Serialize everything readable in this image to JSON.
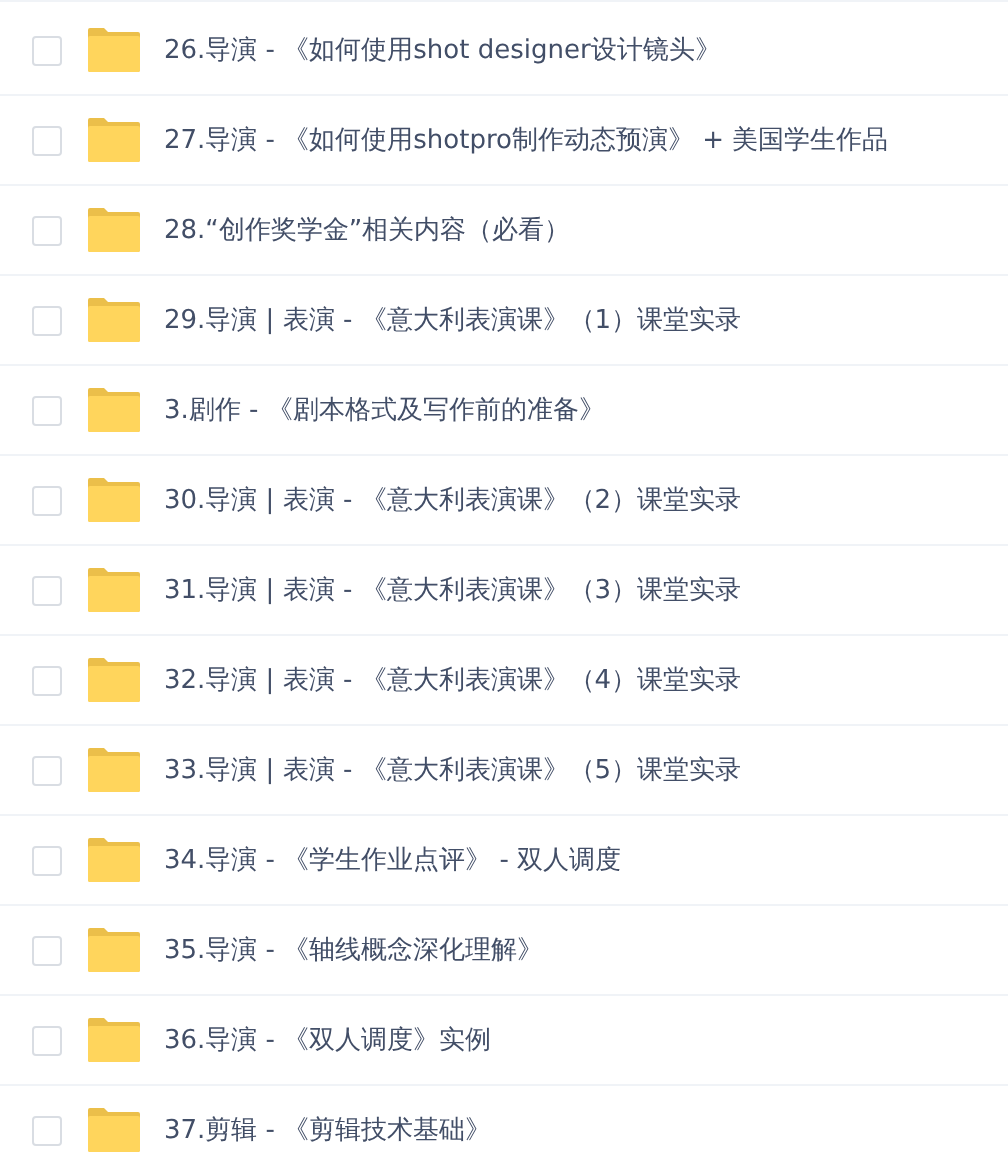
{
  "files": [
    {
      "name": "26.导演 - 《如何使用shot designer设计镜头》",
      "checked": false
    },
    {
      "name": "27.导演 - 《如何使用shotpro制作动态预演》 + 美国学生作品",
      "checked": false
    },
    {
      "name": "28.“创作奖学金”相关内容（必看）",
      "checked": false
    },
    {
      "name": "29.导演 | 表演 - 《意大利表演课》（1）课堂实录",
      "checked": false
    },
    {
      "name": "3.剧作 - 《剧本格式及写作前的准备》",
      "checked": false
    },
    {
      "name": "30.导演 | 表演 - 《意大利表演课》（2）课堂实录",
      "checked": false
    },
    {
      "name": "31.导演 | 表演 - 《意大利表演课》（3）课堂实录",
      "checked": false
    },
    {
      "name": "32.导演 | 表演 - 《意大利表演课》（4）课堂实录",
      "checked": false
    },
    {
      "name": "33.导演 | 表演 - 《意大利表演课》（5）课堂实录",
      "checked": false
    },
    {
      "name": "34.导演 - 《学生作业点评》 - 双人调度",
      "checked": false
    },
    {
      "name": "35.导演 - 《轴线概念深化理解》",
      "checked": false
    },
    {
      "name": "36.导演 - 《双人调度》实例",
      "checked": false
    },
    {
      "name": "37.剪辑 - 《剪辑技术基础》",
      "checked": false
    }
  ]
}
